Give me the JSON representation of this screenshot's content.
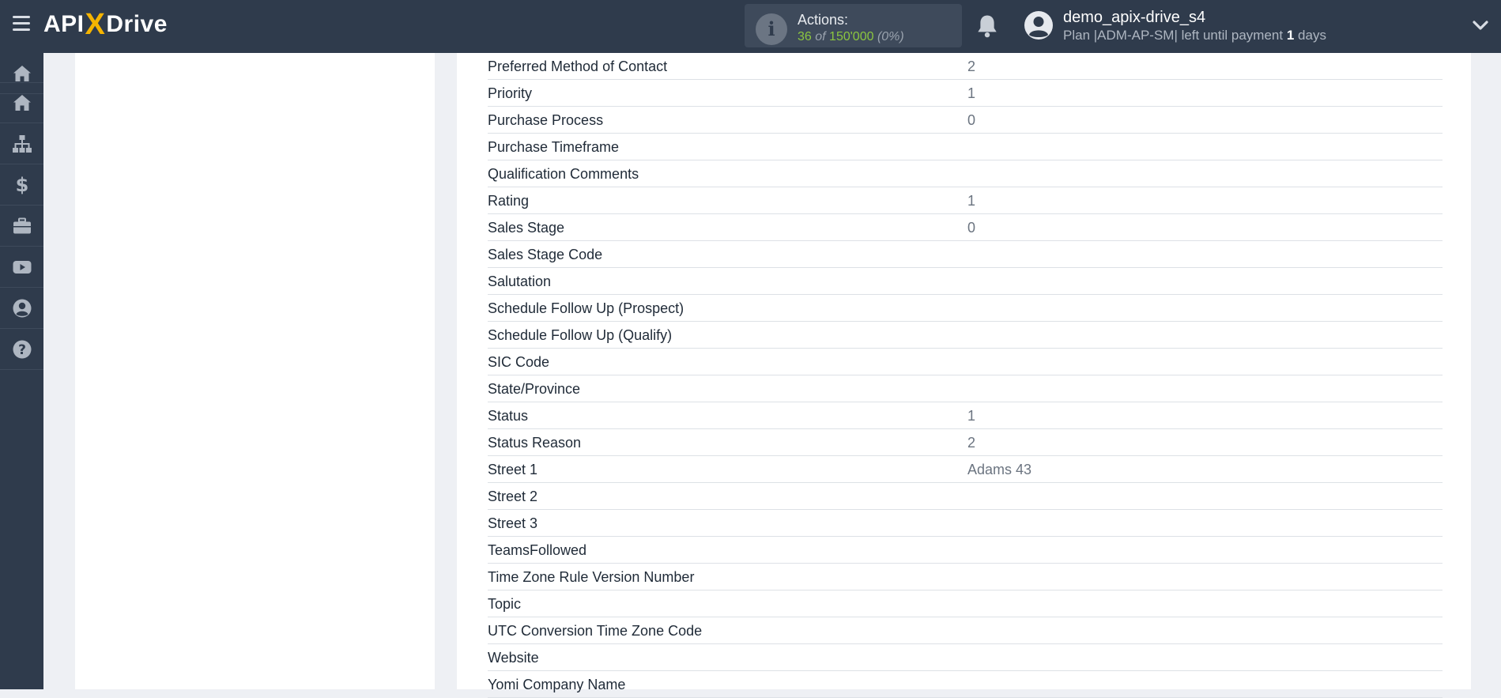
{
  "brand": {
    "part1": "API",
    "part2": "X",
    "part3": "Drive"
  },
  "actions": {
    "label": "Actions:",
    "used": "36",
    "of": "of",
    "total": "150'000",
    "percent": "(0%)"
  },
  "user": {
    "name": "demo_apix-drive_s4",
    "plan_prefix": "Plan |ADM-AP-SM| left until payment",
    "days_count": "1",
    "days_suffix": "days"
  },
  "sidebar": {
    "items": [
      {
        "icon": "home-icon"
      },
      {
        "icon": "sitemap-icon"
      },
      {
        "icon": "dollar-icon"
      },
      {
        "icon": "briefcase-icon"
      },
      {
        "icon": "youtube-icon"
      },
      {
        "icon": "user-circle-icon"
      },
      {
        "icon": "help-icon"
      }
    ]
  },
  "fields": [
    {
      "name": "Preferred Method of Contact",
      "value": "2"
    },
    {
      "name": "Priority",
      "value": "1"
    },
    {
      "name": "Purchase Process",
      "value": "0"
    },
    {
      "name": "Purchase Timeframe",
      "value": ""
    },
    {
      "name": "Qualification Comments",
      "value": ""
    },
    {
      "name": "Rating",
      "value": "1"
    },
    {
      "name": "Sales Stage",
      "value": "0"
    },
    {
      "name": "Sales Stage Code",
      "value": ""
    },
    {
      "name": "Salutation",
      "value": ""
    },
    {
      "name": "Schedule Follow Up (Prospect)",
      "value": ""
    },
    {
      "name": "Schedule Follow Up (Qualify)",
      "value": ""
    },
    {
      "name": "SIC Code",
      "value": ""
    },
    {
      "name": "State/Province",
      "value": ""
    },
    {
      "name": "Status",
      "value": "1"
    },
    {
      "name": "Status Reason",
      "value": "2"
    },
    {
      "name": "Street 1",
      "value": "Adams 43"
    },
    {
      "name": "Street 2",
      "value": ""
    },
    {
      "name": "Street 3",
      "value": ""
    },
    {
      "name": "TeamsFollowed",
      "value": ""
    },
    {
      "name": "Time Zone Rule Version Number",
      "value": ""
    },
    {
      "name": "Topic",
      "value": ""
    },
    {
      "name": "UTC Conversion Time Zone Code",
      "value": ""
    },
    {
      "name": "Website",
      "value": ""
    },
    {
      "name": "Yomi Company Name",
      "value": ""
    }
  ],
  "colors": {
    "topbar": "#2f3b4c",
    "accent_green": "#8cc63f",
    "logo_x": "#f5b400"
  }
}
